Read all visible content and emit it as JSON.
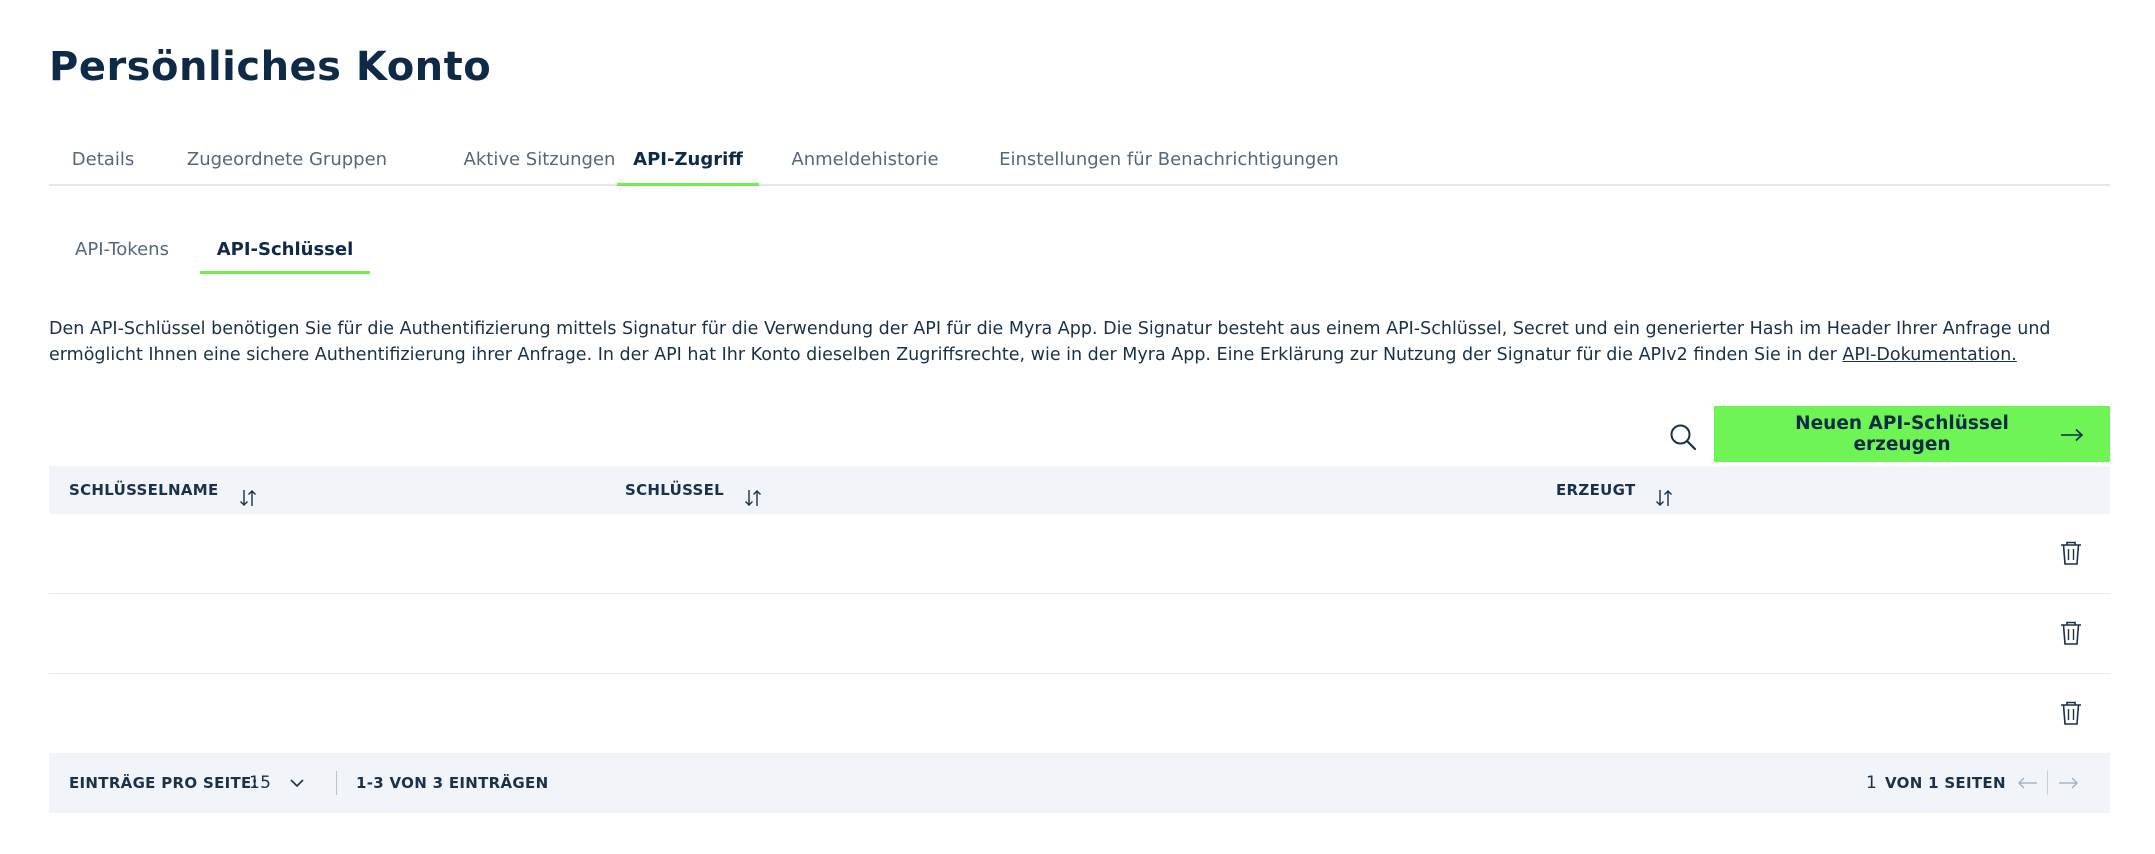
{
  "page": {
    "title": "Persönliches Konto"
  },
  "tabs": [
    {
      "label": "Details"
    },
    {
      "label": "Zugeordnete Gruppen"
    },
    {
      "label": "Aktive Sitzungen"
    },
    {
      "label": "API-Zugriff",
      "active": true
    },
    {
      "label": "Anmeldehistorie"
    },
    {
      "label": "Einstellungen für Benachrichtigungen"
    }
  ],
  "subtabs": [
    {
      "label": "API-Tokens"
    },
    {
      "label": "API-Schlüssel",
      "active": true
    }
  ],
  "description": {
    "text": "Den API-Schlüssel benötigen Sie für die Authentifizierung mittels Signatur für die Verwendung der API für die Myra App. Die Signatur besteht aus einem API-Schlüssel, Secret und ein generierter Hash im Header Ihrer Anfrage und ermöglicht Ihnen eine sichere Authentifizierung ihrer Anfrage. In der API hat Ihr Konto dieselben Zugriffsrechte, wie in der Myra App. Eine Erklärung zur Nutzung der Signatur für die APIv2 finden Sie in der ",
    "link_label": "API-Dokumentation."
  },
  "toolbar": {
    "search_icon": "search-icon",
    "create_label": "Neuen API-Schlüssel erzeugen",
    "create_icon": "arrow-right-icon"
  },
  "table": {
    "columns": [
      {
        "label": "SCHLÜSSELNAME"
      },
      {
        "label": "SCHLÜSSEL"
      },
      {
        "label": "ERZEUGT"
      }
    ],
    "sort_icon": "sort-icon",
    "row_action_icon": "trash-icon",
    "rows": [
      {
        "name": "",
        "key": "",
        "created": ""
      },
      {
        "name": "",
        "key": "",
        "created": ""
      },
      {
        "name": "",
        "key": "",
        "created": ""
      }
    ]
  },
  "footer": {
    "per_page_label": "EINTRÄGE PRO SEITE:",
    "per_page_value": "15",
    "range_label": "1-3 VON 3 EINTRÄGEN",
    "current_page": "1",
    "pages_label": "VON 1 SEITEN",
    "prev_icon": "arrow-left-icon",
    "next_icon": "arrow-right-icon"
  },
  "colors": {
    "accent": "#6ef454",
    "text_dark": "#0e2a47",
    "table_header_bg": "#f1f4f8"
  }
}
